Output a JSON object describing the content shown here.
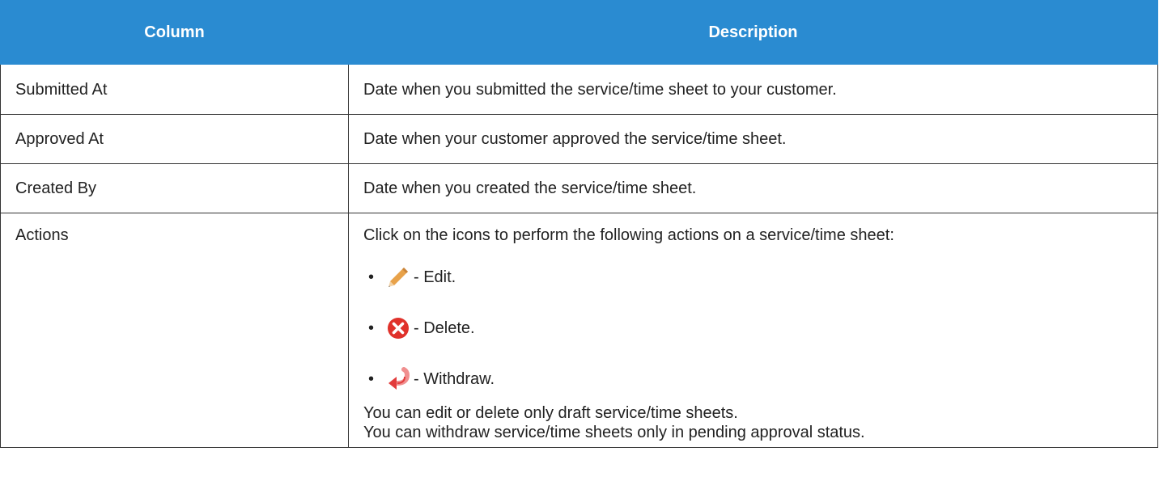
{
  "header": {
    "column": "Column",
    "description": "Description"
  },
  "rows": [
    {
      "column": "Submitted At",
      "description": "Date when you submitted the service/time sheet to your customer."
    },
    {
      "column": "Approved At",
      "description": "Date when your customer approved the service/time sheet."
    },
    {
      "column": "Created By",
      "description": "Date when you created the service/time sheet."
    }
  ],
  "actions_row": {
    "column": "Actions",
    "intro": "Click on the icons to perform the following actions on a service/time sheet:",
    "items": [
      {
        "icon": "pencil-icon",
        "bullet": "•",
        "label": "- Edit."
      },
      {
        "icon": "delete-icon",
        "bullet": "•",
        "label": "- Delete."
      },
      {
        "icon": "withdraw-icon",
        "bullet": "•",
        "label": "- Withdraw."
      }
    ],
    "note1": "You can edit or delete only draft service/time sheets.",
    "note2": "You can withdraw service/time sheets only in pending approval status."
  },
  "colors": {
    "header_bg": "#2a8bd1",
    "header_text": "#ffffff",
    "border": "#333333",
    "delete_icon": "#e0322b",
    "pencil_icon": "#e8a24a",
    "withdraw_icon": "#e23b3b"
  }
}
